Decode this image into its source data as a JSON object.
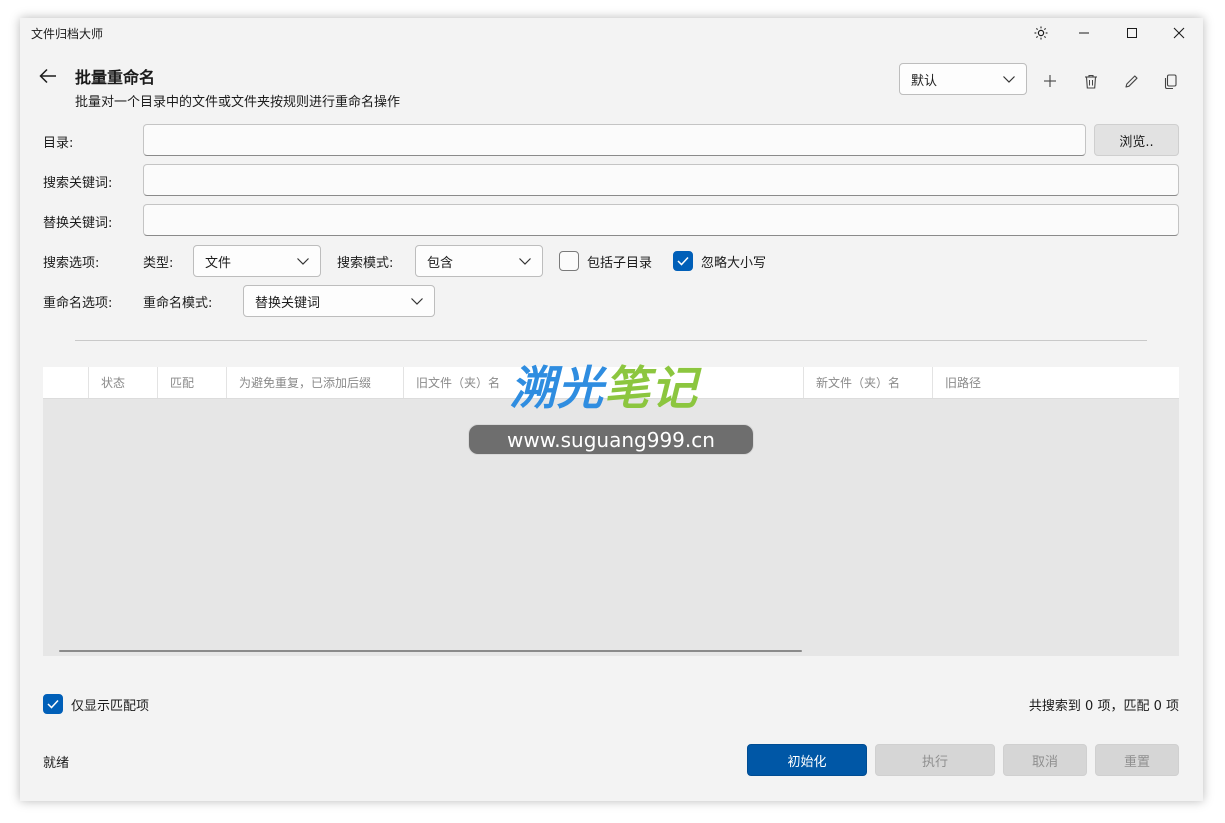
{
  "window": {
    "title": "文件归档大师"
  },
  "page": {
    "title": "批量重命名",
    "subtitle": "批量对一个目录中的文件或文件夹按规则进行重命名操作"
  },
  "preset": {
    "selected": "默认"
  },
  "toolbar": {
    "icons": [
      "add-icon",
      "delete-icon",
      "edit-icon",
      "copy-icon"
    ]
  },
  "form": {
    "directory_label": "目录:",
    "directory_value": "",
    "browse_label": "浏览..",
    "search_keyword_label": "搜索关键词:",
    "search_keyword_value": "",
    "replace_keyword_label": "替换关键词:",
    "replace_keyword_value": "",
    "search_options_label": "搜索选项:",
    "type_label": "类型:",
    "type_value": "文件",
    "search_mode_label": "搜索模式:",
    "search_mode_value": "包含",
    "include_subdirs_label": "包括子目录",
    "include_subdirs_checked": false,
    "ignore_case_label": "忽略大小写",
    "ignore_case_checked": true,
    "rename_options_label": "重命名选项:",
    "rename_mode_label": "重命名模式:",
    "rename_mode_value": "替换关键词"
  },
  "table": {
    "columns": [
      "状态",
      "匹配",
      "为避免重复，已添加后缀",
      "旧文件（夹）名",
      "新文件（夹）名",
      "旧路径"
    ],
    "rows": []
  },
  "footer": {
    "show_matched_only_label": "仅显示匹配项",
    "show_matched_only_checked": true,
    "summary": "共搜索到 0 项，匹配 0 项",
    "status": "就绪",
    "init_label": "初始化",
    "execute_label": "执行",
    "cancel_label": "取消",
    "reset_label": "重置"
  },
  "watermark": {
    "title": "溯光笔记",
    "url": "www.suguang999.cn"
  },
  "colors": {
    "accent": "#005fb8",
    "primary_button": "#0057a6",
    "watermark_blue": "#2f8de0",
    "watermark_green": "#8cc63f"
  }
}
